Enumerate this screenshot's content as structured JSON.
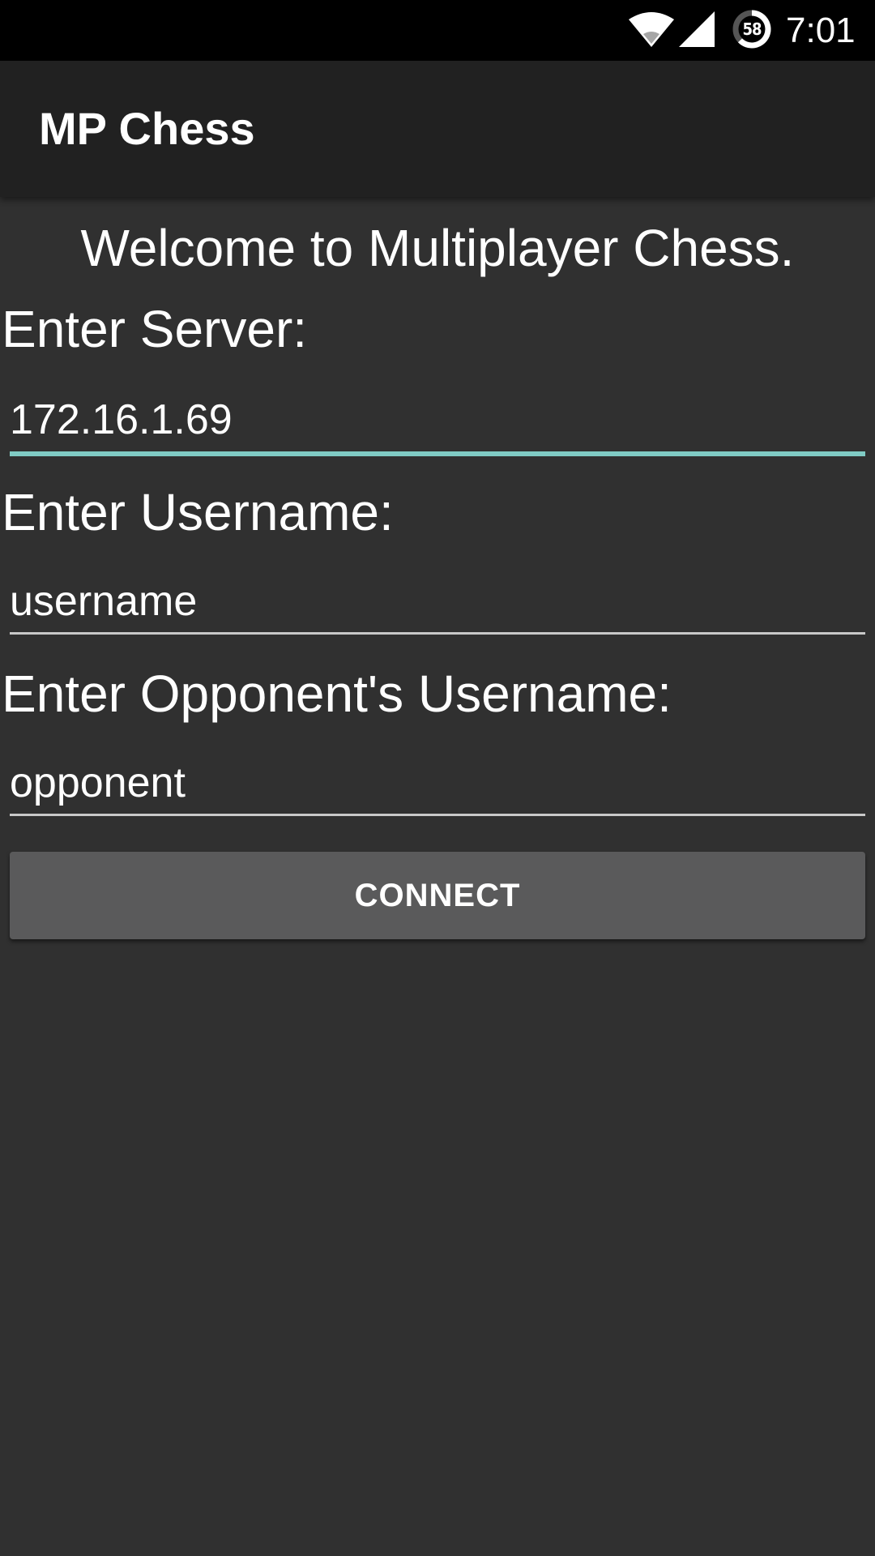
{
  "status_bar": {
    "time": "7:01",
    "battery_percent": "58",
    "icons": [
      "wifi-icon",
      "cell-signal-icon",
      "battery-icon"
    ]
  },
  "app_bar": {
    "title": "MP Chess"
  },
  "main": {
    "welcome_text": "Welcome to Multiplayer Chess.",
    "server": {
      "label": "Enter Server:",
      "value": "172.16.1.69",
      "focused": true
    },
    "username": {
      "label": "Enter Username:",
      "value": "username"
    },
    "opponent": {
      "label": "Enter Opponent's Username:",
      "value": "opponent"
    },
    "connect_label": "CONNECT"
  },
  "colors": {
    "background": "#303030",
    "app_bar": "#212121",
    "accent": "#80cbc4",
    "button": "#5a5a5b"
  }
}
